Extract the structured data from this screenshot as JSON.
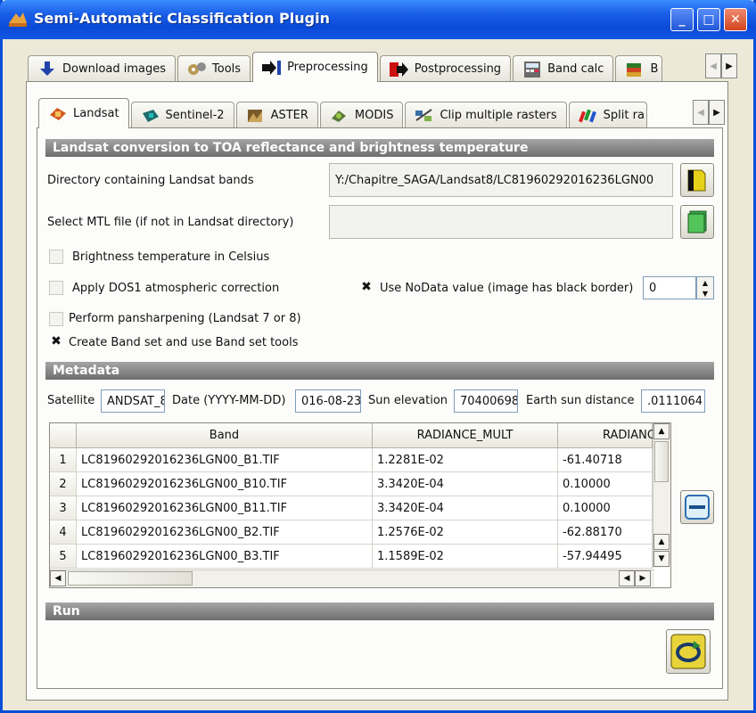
{
  "window": {
    "title": "Semi-Automatic Classification Plugin",
    "minimize": "_",
    "maximize": "□",
    "close": "✕"
  },
  "main_tabs": [
    {
      "label": "Download images",
      "icon": "download-arrow-icon"
    },
    {
      "label": "Tools",
      "icon": "tools-gears-icon"
    },
    {
      "label": "Preprocessing",
      "icon": "preprocessing-arrow-icon"
    },
    {
      "label": "Postprocessing",
      "icon": "postprocessing-arrow-icon"
    },
    {
      "label": "Band calc",
      "icon": "calculator-icon"
    },
    {
      "label": "B",
      "icon": "book-icon"
    }
  ],
  "sub_tabs": [
    {
      "label": "Landsat",
      "icon": "landsat-satellite-icon"
    },
    {
      "label": "Sentinel-2",
      "icon": "sentinel-satellite-icon"
    },
    {
      "label": "ASTER",
      "icon": "aster-icon"
    },
    {
      "label": "MODIS",
      "icon": "modis-icon"
    },
    {
      "label": "Clip multiple rasters",
      "icon": "clip-icon"
    },
    {
      "label": "Split ra",
      "icon": "split-icon"
    }
  ],
  "conversion": {
    "section_title": "Landsat conversion to TOA reflectance and brightness temperature",
    "dir_label": "Directory containing Landsat bands",
    "dir_value": "Y:/Chapitre_SAGA/Landsat8/LC81960292016236LGN00",
    "mtl_label": "Select MTL file (if not in Landsat directory)",
    "mtl_value": "",
    "celsius_label": "Brightness temperature in Celsius",
    "dos1_label": "Apply DOS1 atmospheric correction",
    "nodata_label": "Use NoData value (image has black border)",
    "nodata_value": "0",
    "pansharpen_label": "Perform pansharpening (Landsat 7 or 8)",
    "bandset_label": "Create Band set and use Band set tools",
    "check_mark": "✖"
  },
  "metadata": {
    "section_title": "Metadata",
    "satellite_label": "Satellite",
    "satellite_value": "ANDSAT_8",
    "date_label": "Date (YYYY-MM-DD)",
    "date_value": "016-08-23",
    "sun_elev_label": "Sun elevation",
    "sun_elev_value": "70400698",
    "earth_sun_label": "Earth sun distance",
    "earth_sun_value": ".0111064"
  },
  "table": {
    "headers": [
      "Band",
      "RADIANCE_MULT",
      "RADIANC"
    ],
    "rows": [
      {
        "num": "1",
        "band": "LC81960292016236LGN00_B1.TIF",
        "mult": "1.2281E-02",
        "add": "-61.40718"
      },
      {
        "num": "2",
        "band": "LC81960292016236LGN00_B10.TIF",
        "mult": "3.3420E-04",
        "add": "0.10000"
      },
      {
        "num": "3",
        "band": "LC81960292016236LGN00_B11.TIF",
        "mult": "3.3420E-04",
        "add": "0.10000"
      },
      {
        "num": "4",
        "band": "LC81960292016236LGN00_B2.TIF",
        "mult": "1.2576E-02",
        "add": "-62.88170"
      },
      {
        "num": "5",
        "band": "LC81960292016236LGN00_B3.TIF",
        "mult": "1.1589E-02",
        "add": "-57.94495"
      }
    ]
  },
  "run": {
    "section_title": "Run"
  }
}
